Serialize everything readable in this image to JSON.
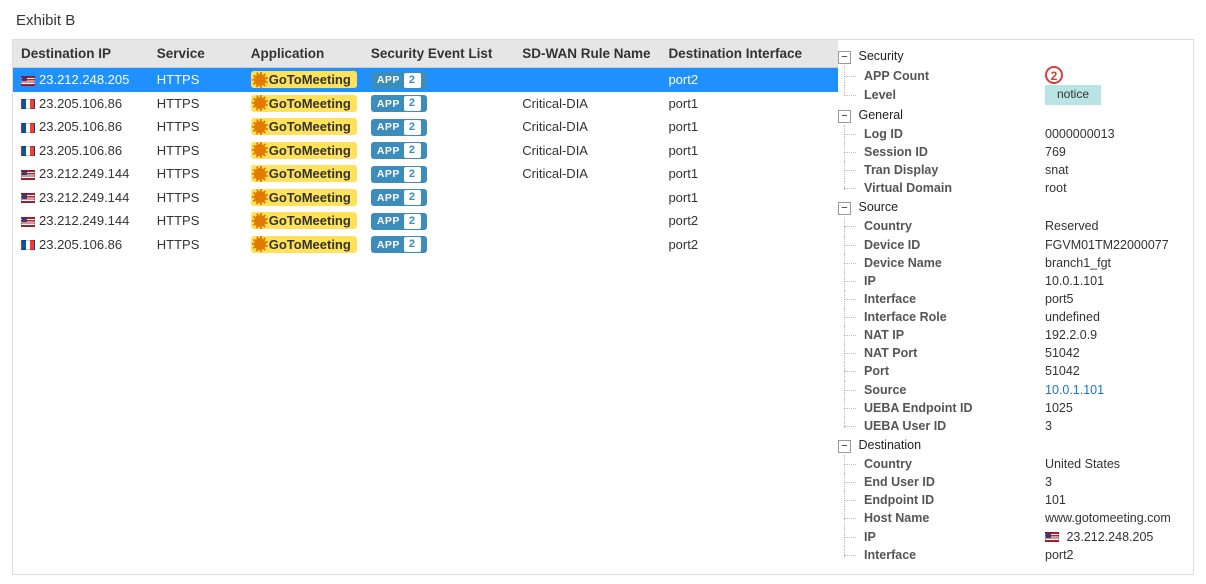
{
  "title": "Exhibit B",
  "columns": {
    "dest": "Destination IP",
    "svc": "Service",
    "app": "Application",
    "sec": "Security Event List",
    "rule": "SD-WAN Rule Name",
    "intf": "Destination Interface"
  },
  "app_chip_label": "APP",
  "rows": [
    {
      "flag": "us",
      "dest": "23.212.248.205",
      "svc": "HTTPS",
      "app": "GoToMeeting",
      "appcount": "2",
      "rule": "",
      "intf": "port2",
      "sel": true
    },
    {
      "flag": "fr",
      "dest": "23.205.106.86",
      "svc": "HTTPS",
      "app": "GoToMeeting",
      "appcount": "2",
      "rule": "Critical-DIA",
      "intf": "port1",
      "sel": false
    },
    {
      "flag": "fr",
      "dest": "23.205.106.86",
      "svc": "HTTPS",
      "app": "GoToMeeting",
      "appcount": "2",
      "rule": "Critical-DIA",
      "intf": "port1",
      "sel": false
    },
    {
      "flag": "fr",
      "dest": "23.205.106.86",
      "svc": "HTTPS",
      "app": "GoToMeeting",
      "appcount": "2",
      "rule": "Critical-DIA",
      "intf": "port1",
      "sel": false
    },
    {
      "flag": "us",
      "dest": "23.212.249.144",
      "svc": "HTTPS",
      "app": "GoToMeeting",
      "appcount": "2",
      "rule": "Critical-DIA",
      "intf": "port1",
      "sel": false
    },
    {
      "flag": "us",
      "dest": "23.212.249.144",
      "svc": "HTTPS",
      "app": "GoToMeeting",
      "appcount": "2",
      "rule": "",
      "intf": "port1",
      "sel": false
    },
    {
      "flag": "us",
      "dest": "23.212.249.144",
      "svc": "HTTPS",
      "app": "GoToMeeting",
      "appcount": "2",
      "rule": "",
      "intf": "port2",
      "sel": false
    },
    {
      "flag": "fr",
      "dest": "23.205.106.86",
      "svc": "HTTPS",
      "app": "GoToMeeting",
      "appcount": "2",
      "rule": "",
      "intf": "port2",
      "sel": false
    }
  ],
  "details": {
    "Security": {
      "app_count_label": "APP Count",
      "app_count_value": "2",
      "level_label": "Level",
      "level_value": "notice"
    },
    "General": {
      "log_id": {
        "k": "Log ID",
        "v": "0000000013"
      },
      "session_id": {
        "k": "Session ID",
        "v": "769"
      },
      "tran_display": {
        "k": "Tran Display",
        "v": "snat"
      },
      "virtual_domain": {
        "k": "Virtual Domain",
        "v": "root"
      }
    },
    "Source": {
      "country": {
        "k": "Country",
        "v": "Reserved"
      },
      "device_id": {
        "k": "Device ID",
        "v": "FGVM01TM22000077"
      },
      "device_name": {
        "k": "Device Name",
        "v": "branch1_fgt"
      },
      "ip": {
        "k": "IP",
        "v": "10.0.1.101"
      },
      "interface": {
        "k": "Interface",
        "v": "port5"
      },
      "interface_role": {
        "k": "Interface Role",
        "v": "undefined"
      },
      "nat_ip": {
        "k": "NAT IP",
        "v": "192.2.0.9"
      },
      "nat_port": {
        "k": "NAT Port",
        "v": "51042"
      },
      "port": {
        "k": "Port",
        "v": "51042"
      },
      "source": {
        "k": "Source",
        "v": "10.0.1.101"
      },
      "ueba_ep_id": {
        "k": "UEBA Endpoint ID",
        "v": "1025"
      },
      "ueba_user_id": {
        "k": "UEBA User ID",
        "v": "3"
      }
    },
    "Destination": {
      "country": {
        "k": "Country",
        "v": "United States"
      },
      "end_user_id": {
        "k": "End User ID",
        "v": "3"
      },
      "endpoint_id": {
        "k": "Endpoint ID",
        "v": "101"
      },
      "host_name": {
        "k": "Host Name",
        "v": "www.gotomeeting.com"
      },
      "ip": {
        "k": "IP",
        "v": "23.212.248.205"
      },
      "interface": {
        "k": "Interface",
        "v": "port2"
      }
    },
    "group_labels": {
      "security": "Security",
      "general": "General",
      "source": "Source",
      "destination": "Destination"
    }
  }
}
